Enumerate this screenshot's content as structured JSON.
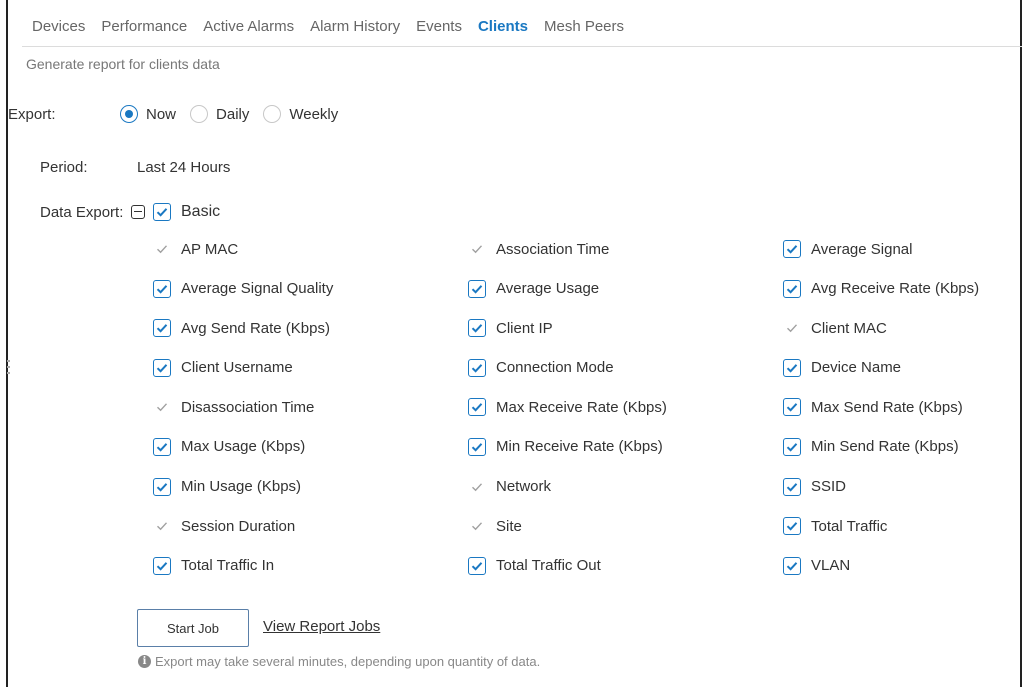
{
  "tabs": [
    {
      "label": "Devices",
      "active": false
    },
    {
      "label": "Performance",
      "active": false
    },
    {
      "label": "Active Alarms",
      "active": false
    },
    {
      "label": "Alarm History",
      "active": false
    },
    {
      "label": "Events",
      "active": false
    },
    {
      "label": "Clients",
      "active": true
    },
    {
      "label": "Mesh Peers",
      "active": false
    }
  ],
  "subtitle": "Generate report for clients data",
  "export": {
    "label": "Export:",
    "options": [
      {
        "label": "Now",
        "selected": true
      },
      {
        "label": "Daily",
        "selected": false
      },
      {
        "label": "Weekly",
        "selected": false
      }
    ]
  },
  "period": {
    "label": "Period:",
    "value": "Last 24 Hours"
  },
  "data_export": {
    "label": "Data Export:",
    "group_label": "Basic",
    "group_checked": true,
    "fields": [
      {
        "label": "AP MAC",
        "state": "disabled"
      },
      {
        "label": "Association Time",
        "state": "disabled"
      },
      {
        "label": "Average Signal",
        "state": "checked"
      },
      {
        "label": "Average Signal Quality",
        "state": "checked"
      },
      {
        "label": "Average Usage",
        "state": "checked"
      },
      {
        "label": "Avg Receive Rate (Kbps)",
        "state": "checked"
      },
      {
        "label": "Avg Send Rate (Kbps)",
        "state": "checked"
      },
      {
        "label": "Client IP",
        "state": "checked"
      },
      {
        "label": "Client MAC",
        "state": "disabled"
      },
      {
        "label": "Client Username",
        "state": "checked"
      },
      {
        "label": "Connection Mode",
        "state": "checked"
      },
      {
        "label": "Device Name",
        "state": "checked"
      },
      {
        "label": "Disassociation Time",
        "state": "disabled"
      },
      {
        "label": "Max Receive Rate (Kbps)",
        "state": "checked"
      },
      {
        "label": "Max Send Rate (Kbps)",
        "state": "checked"
      },
      {
        "label": "Max Usage (Kbps)",
        "state": "checked"
      },
      {
        "label": "Min Receive Rate (Kbps)",
        "state": "checked"
      },
      {
        "label": "Min Send Rate (Kbps)",
        "state": "checked"
      },
      {
        "label": "Min Usage (Kbps)",
        "state": "checked"
      },
      {
        "label": "Network",
        "state": "disabled"
      },
      {
        "label": "SSID",
        "state": "checked"
      },
      {
        "label": "Session Duration",
        "state": "disabled"
      },
      {
        "label": "Site",
        "state": "disabled"
      },
      {
        "label": "Total Traffic",
        "state": "checked"
      },
      {
        "label": "Total Traffic In",
        "state": "checked"
      },
      {
        "label": "Total Traffic Out",
        "state": "checked"
      },
      {
        "label": "VLAN",
        "state": "checked"
      }
    ]
  },
  "actions": {
    "start_job_label": "Start Job",
    "view_jobs_label": "View Report Jobs"
  },
  "note": "Export may take several minutes, depending upon quantity of data.",
  "colors": {
    "accent": "#1a78c2",
    "muted_text": "#777777",
    "disabled_check": "#a0a0a0"
  },
  "icons": {
    "collapse": "minus-square-icon",
    "info": "info-circle-icon",
    "check": "check-icon"
  }
}
